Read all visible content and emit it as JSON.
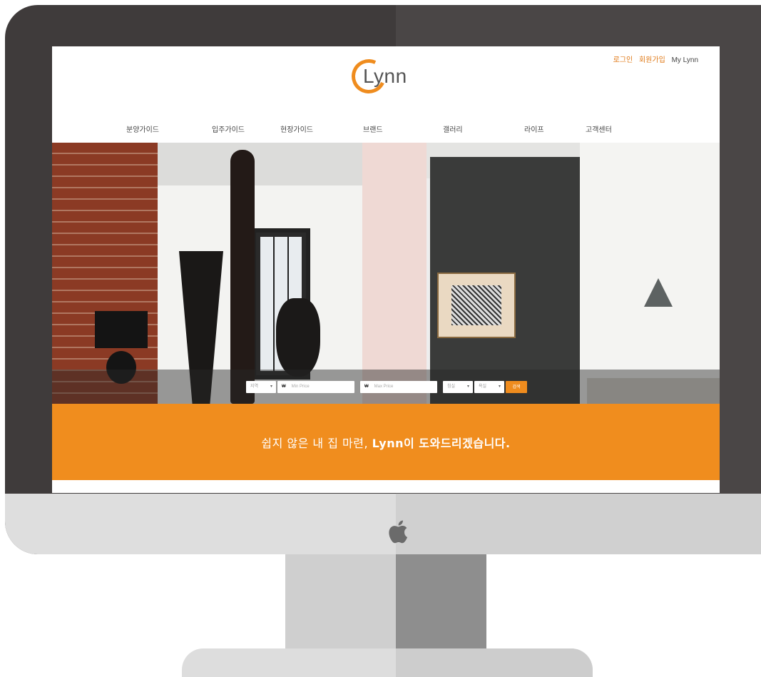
{
  "site": {
    "logo_text": "Lynn",
    "top_links": {
      "login": "로그인",
      "signup": "회원가입",
      "mypage": "My Lynn"
    },
    "nav": [
      "분양가이드",
      "입주가이드",
      "현장가이드",
      "브랜드",
      "갤러리",
      "라이프",
      "고객센터"
    ]
  },
  "search": {
    "region_select": "지역",
    "currency": "₩",
    "min_price_placeholder": "Min Price",
    "max_price_placeholder": "Max Price",
    "room_select": "침실",
    "bath_select": "욕실",
    "search_button": "검색"
  },
  "banner": {
    "text_plain": "쉽지 않은 내 집 마련, ",
    "text_bold": "Lynn이 도와드리겠습니다."
  },
  "colors": {
    "accent": "#f08d1e",
    "bezel": "#3f3b3b"
  },
  "icons": {
    "device_logo": "apple-logo-icon",
    "dropdown": "chevron-down-icon"
  }
}
